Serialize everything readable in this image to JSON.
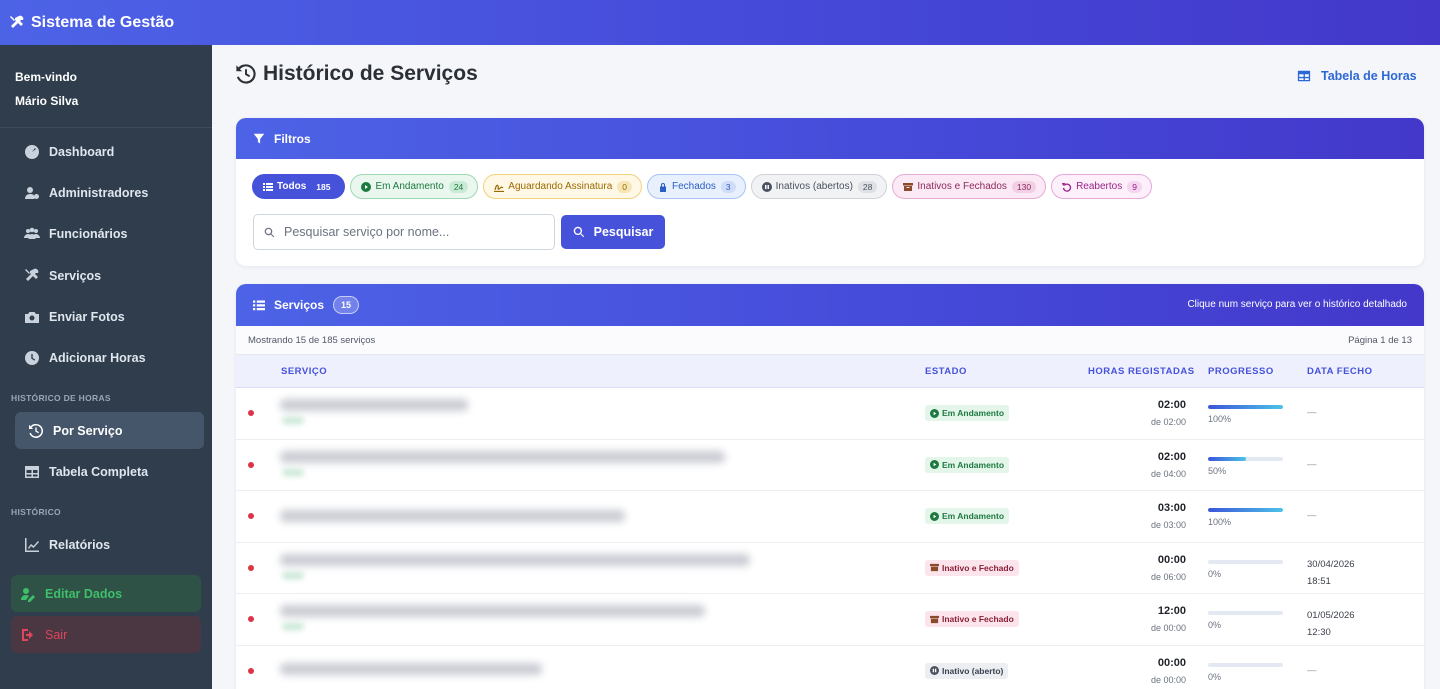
{
  "app": {
    "title": "Sistema de Gestão"
  },
  "user": {
    "greeting": "Bem-vindo",
    "name": "Mário Silva"
  },
  "sidebar": {
    "items": [
      {
        "label": "Dashboard",
        "icon": "gauge-icon"
      },
      {
        "label": "Administradores",
        "icon": "user-gear-icon"
      },
      {
        "label": "Funcionários",
        "icon": "users-icon"
      },
      {
        "label": "Serviços",
        "icon": "tools-icon"
      },
      {
        "label": "Enviar Fotos",
        "icon": "camera-icon"
      },
      {
        "label": "Adicionar Horas",
        "icon": "clock-icon"
      }
    ],
    "section_hours": "HISTÓRICO DE HORAS",
    "hours_items": [
      {
        "label": "Por Serviço",
        "icon": "history-icon",
        "active": true
      },
      {
        "label": "Tabela Completa",
        "icon": "table-icon"
      }
    ],
    "section_history": "HISTÓRICO",
    "history_items": [
      {
        "label": "Relatórios",
        "icon": "chart-line-icon"
      }
    ],
    "edit_label": "Editar Dados",
    "logout_label": "Sair"
  },
  "page": {
    "title": "Histórico de Serviços",
    "table_link": "Tabela de Horas"
  },
  "filters": {
    "header": "Filtros",
    "chips": [
      {
        "label": "Todos",
        "count": "185"
      },
      {
        "label": "Em Andamento",
        "count": "24"
      },
      {
        "label": "Aguardando Assinatura",
        "count": "0"
      },
      {
        "label": "Fechados",
        "count": "3"
      },
      {
        "label": "Inativos (abertos)",
        "count": "28"
      },
      {
        "label": "Inativos e Fechados",
        "count": "130"
      },
      {
        "label": "Reabertos",
        "count": "9"
      }
    ],
    "search_placeholder": "Pesquisar serviço por nome...",
    "search_button": "Pesquisar"
  },
  "services": {
    "header": "Serviços",
    "count": "15",
    "hint": "Clique num serviço para ver o histórico detalhado",
    "showing": "Mostrando 15 de 185 serviços",
    "page_info": "Página 1 de 13",
    "columns": [
      "SERVIÇO",
      "ESTADO",
      "HORAS REGISTADAS",
      "PROGRESSO",
      "DATA FECHO"
    ],
    "rows": [
      {
        "state": "Em Andamento",
        "hours": "02:00",
        "of": "de 02:00",
        "progress": "100%",
        "date": "—",
        "time": ""
      },
      {
        "state": "Em Andamento",
        "hours": "02:00",
        "of": "de 04:00",
        "progress": "50%",
        "date": "—",
        "time": ""
      },
      {
        "state": "Em Andamento",
        "hours": "03:00",
        "of": "de 03:00",
        "progress": "100%",
        "date": "—",
        "time": ""
      },
      {
        "state": "Inativo e Fechado",
        "hours": "00:00",
        "of": "de 06:00",
        "progress": "0%",
        "date": "30/04/2026",
        "time": "18:51"
      },
      {
        "state": "Inativo e Fechado",
        "hours": "12:00",
        "of": "de 00:00",
        "progress": "0%",
        "date": "01/05/2026",
        "time": "12:30"
      },
      {
        "state": "Inativo (aberto)",
        "hours": "00:00",
        "of": "de 00:00",
        "progress": "0%",
        "date": "—",
        "time": ""
      }
    ]
  },
  "colors": {
    "accent": "#4552d9",
    "sidebar": "#2f3d4c",
    "status_dot": "#dc3545"
  }
}
